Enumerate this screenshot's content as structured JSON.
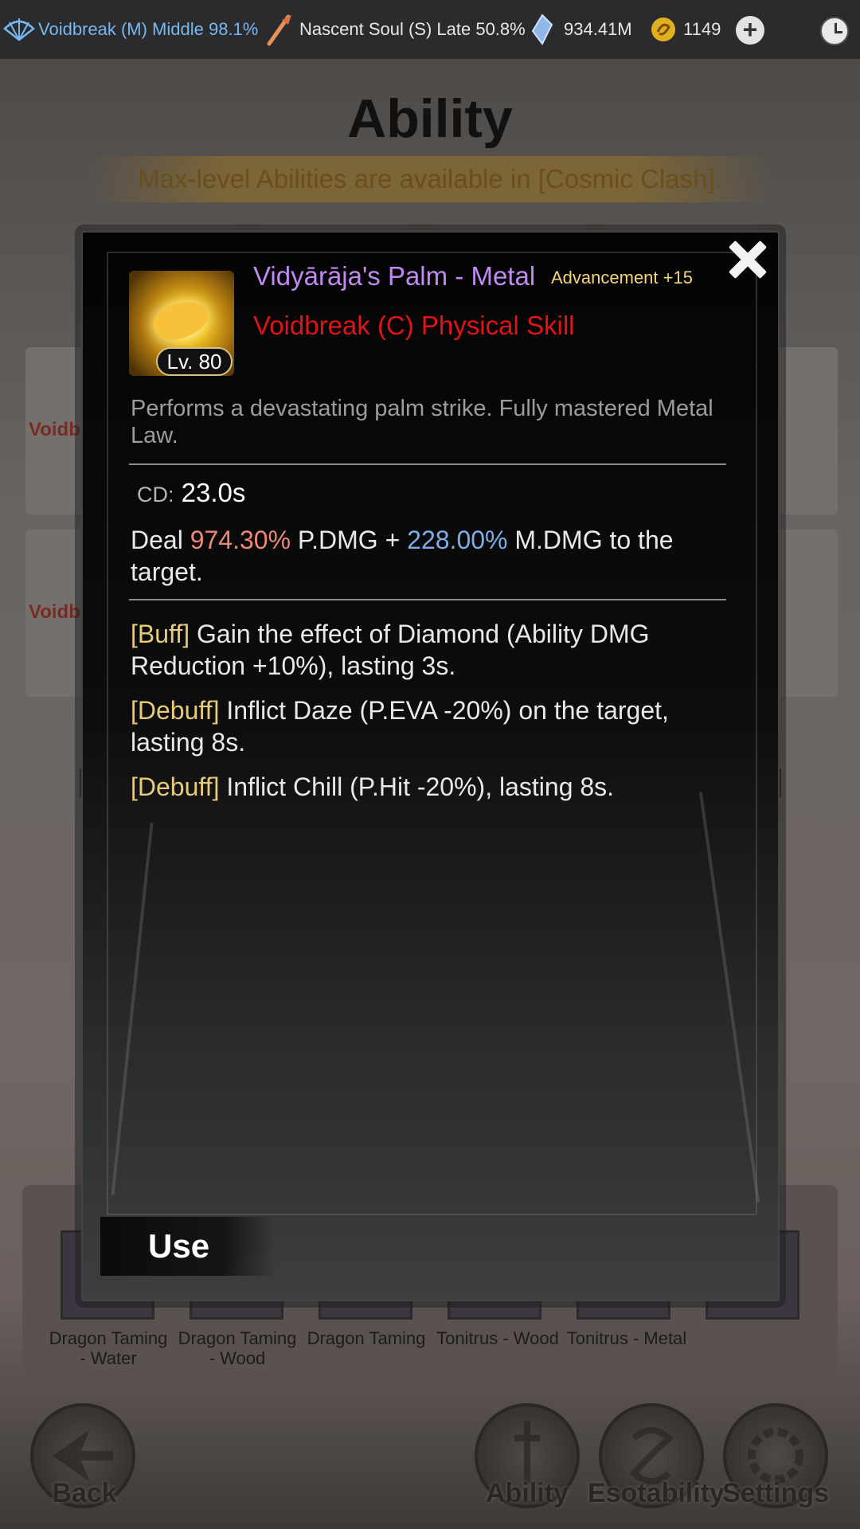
{
  "topbar": {
    "realm": "Voidbreak (M) Middle 98.1%",
    "soul": "Nascent Soul (S) Late 50.8%",
    "crystals": "934.41M",
    "coins": "1149"
  },
  "page": {
    "title": "Ability",
    "banner": "Max-level Abilities are available in [Cosmic Clash].",
    "card1_label": "Voidb",
    "card2_label": "Voidb"
  },
  "bottom": {
    "slots": [
      "Dragon Taming\n- Water",
      "Dragon Taming\n- Wood",
      "Dragon Taming",
      "Tonitrus - Wood",
      "Tonitrus - Metal"
    ],
    "nav": {
      "back": "Back",
      "ability": "Ability",
      "esotability": "Esotability",
      "settings": "Settings"
    }
  },
  "modal": {
    "skill_name": "Vidyārāja's Palm - Metal",
    "advancement": "Advancement +15",
    "skill_type": "Voidbreak (C) Physical Skill",
    "level": "Lv. 80",
    "description": "Performs a devastating palm strike. Fully mastered Metal Law.",
    "cd_label": "CD:",
    "cd_value": "23.0s",
    "deal_prefix": "Deal",
    "pdmg_value": "974.30%",
    "pdmg_label": "P.DMG +",
    "mdmg_value": "228.00%",
    "mdmg_label": "M.DMG to the target.",
    "effects": [
      {
        "tag": "[Buff]",
        "text": "Gain the effect of Diamond (Ability DMG Reduction +10%), lasting 3s."
      },
      {
        "tag": "[Debuff]",
        "text": "Inflict Daze (P.EVA -20%) on the target, lasting 8s."
      },
      {
        "tag": "[Debuff]",
        "text": "Inflict Chill (P.Hit -20%), lasting 8s."
      }
    ],
    "use_label": "Use"
  },
  "colors": {
    "skill_name": "#c08af0",
    "skill_type": "#e01414",
    "pdmg": "#ee8878",
    "mdmg": "#7eaeea",
    "tag": "#e6cb7c"
  }
}
